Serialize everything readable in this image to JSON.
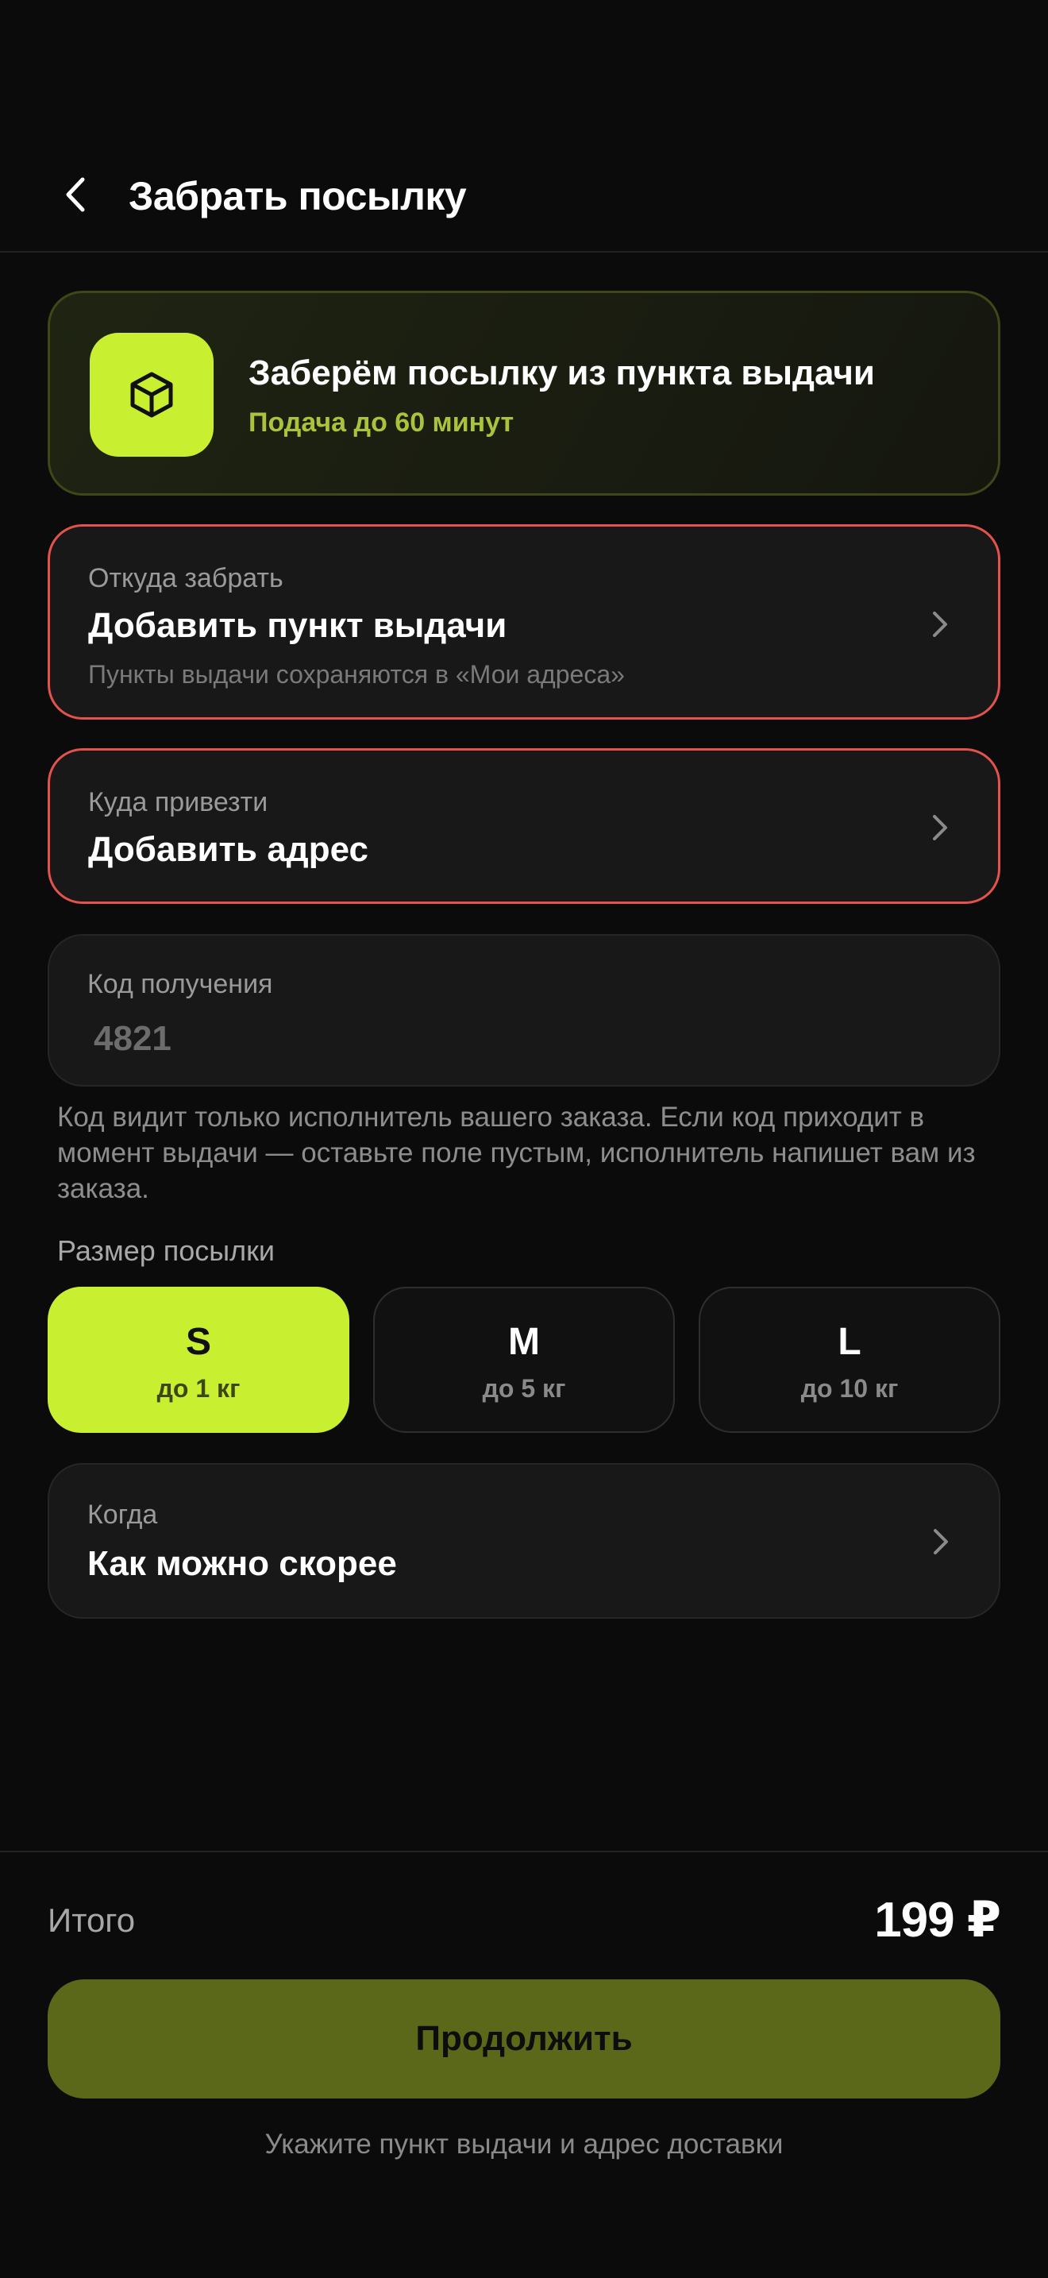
{
  "header": {
    "title": "Забрать посылку",
    "back_icon": "chevron-left-icon"
  },
  "promo": {
    "icon": "box-icon",
    "title": "Заберём посылку из пункта выдачи",
    "subtitle": "Подача до 60 минут",
    "accent_color": "#c8f031"
  },
  "from": {
    "label": "Откуда забрать",
    "value": "Добавить пункт выдачи",
    "hint": "Пункты выдачи сохраняются в «Мои адреса»",
    "state": "error"
  },
  "to": {
    "label": "Куда привезти",
    "value": "Добавить адрес",
    "state": "error"
  },
  "code": {
    "label": "Код получения",
    "placeholder": "4821",
    "value": ""
  },
  "code_note": "Код видит только исполнитель вашего заказа. Если код приходит в момент выдачи — оставьте поле пустым, исполнитель напишет вам из заказа.",
  "size": {
    "title": "Размер посылки",
    "options": [
      {
        "letter": "S",
        "weight": "до 1 кг",
        "selected": true
      },
      {
        "letter": "M",
        "weight": "до 5 кг",
        "selected": false
      },
      {
        "letter": "L",
        "weight": "до 10 кг",
        "selected": false
      }
    ]
  },
  "when": {
    "label": "Когда",
    "value": "Как можно скорее"
  },
  "footer": {
    "total_label": "Итого",
    "total_value": "199 ₽",
    "continue_label": "Продолжить",
    "hint": "Укажите пункт выдачи и адрес доставки"
  },
  "colors": {
    "error": "#e3524b",
    "accent": "#c8f031",
    "button_disabled": "#5b681a",
    "background": "#0b0b0b"
  }
}
